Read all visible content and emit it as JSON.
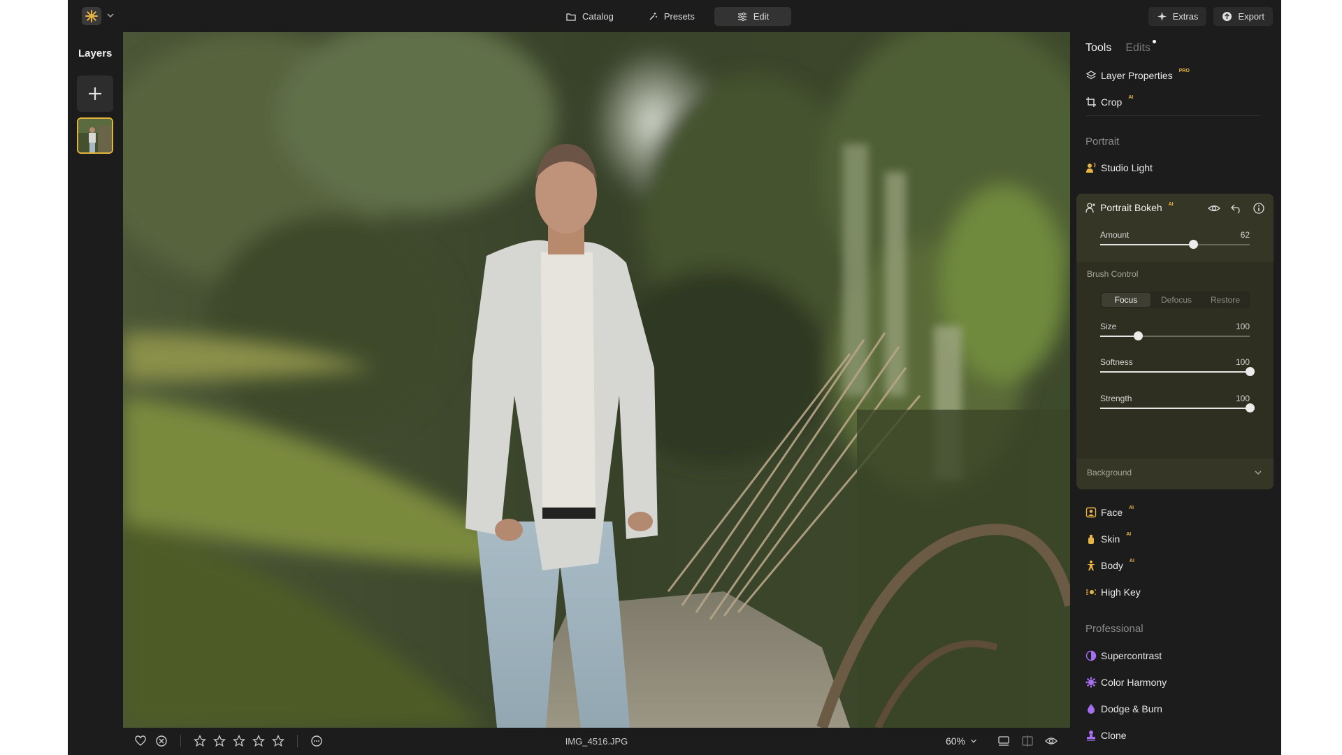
{
  "topbar": {
    "tabs": [
      {
        "label": "Catalog",
        "icon": "folder-icon"
      },
      {
        "label": "Presets",
        "icon": "sparkle-wand-icon"
      },
      {
        "label": "Edit",
        "icon": "sliders-icon",
        "active": true
      }
    ],
    "extras_label": "Extras",
    "export_label": "Export"
  },
  "layers": {
    "title": "Layers"
  },
  "bottombar": {
    "filename": "IMG_4516.JPG",
    "zoom": "60%",
    "rating": 0,
    "max_rating": 5
  },
  "panel": {
    "tabs": [
      {
        "label": "Tools",
        "active": true
      },
      {
        "label": "Edits",
        "has_dot": true
      }
    ],
    "top_tools": [
      {
        "label": "Layer Properties",
        "badge": "PRO"
      },
      {
        "label": "Crop",
        "badge": "AI"
      }
    ],
    "portrait_title": "Portrait",
    "studio_light": "Studio Light",
    "bokeh": {
      "label": "Portrait Bokeh",
      "badge": "AI",
      "amount_label": "Amount",
      "amount_value": "62",
      "amount_fraction": 0.62,
      "brush_control": "Brush Control",
      "modes": [
        "Focus",
        "Defocus",
        "Restore"
      ],
      "active_mode": "Focus",
      "size_label": "Size",
      "size_value": "100",
      "size_fraction": 0.25,
      "softness_label": "Softness",
      "softness_value": "100",
      "softness_fraction": 1.0,
      "strength_label": "Strength",
      "strength_value": "100",
      "strength_fraction": 1.0,
      "background_label": "Background"
    },
    "portrait_tools": [
      {
        "label": "Face",
        "badge": "AI"
      },
      {
        "label": "Skin",
        "badge": "AI"
      },
      {
        "label": "Body",
        "badge": "AI"
      },
      {
        "label": "High Key",
        "badge": ""
      }
    ],
    "professional_title": "Professional",
    "professional_tools": [
      {
        "label": "Supercontrast"
      },
      {
        "label": "Color Harmony"
      },
      {
        "label": "Dodge & Burn"
      },
      {
        "label": "Clone"
      }
    ]
  },
  "colors": {
    "accent_yellow": "#e9b443",
    "accent_purple": "#a66ef0",
    "panel_bg": "#1c1c1c",
    "card_bg": "#363627"
  }
}
